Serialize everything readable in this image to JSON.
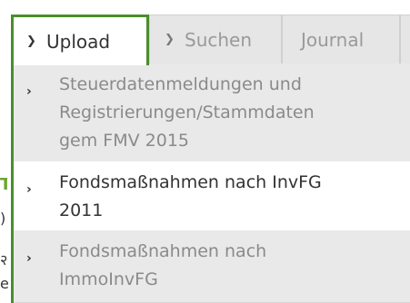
{
  "tabs": {
    "upload": {
      "label": "Upload"
    },
    "suchen": {
      "label": "Suchen"
    },
    "journal": {
      "label": "Journal"
    }
  },
  "menu": {
    "items": [
      {
        "lines": [
          "Steuerdatenmeldungen und",
          "Registrierungen/Stammdaten",
          "gem FMV 2015"
        ]
      },
      {
        "lines": [
          "Fondsmaßnahmen nach InvFG",
          "2011"
        ]
      },
      {
        "lines": [
          "Fondsmaßnahmen nach",
          "ImmoInvFG"
        ]
      }
    ]
  },
  "icons": {
    "tab_chevron": "chevron-down-icon",
    "item_arrow": "chevron-right-icon"
  },
  "colors": {
    "accent": "#4a8d2c",
    "inactive_tab_bg": "#e6e6e6",
    "menu_item_bg": "#e9e9e9"
  }
}
